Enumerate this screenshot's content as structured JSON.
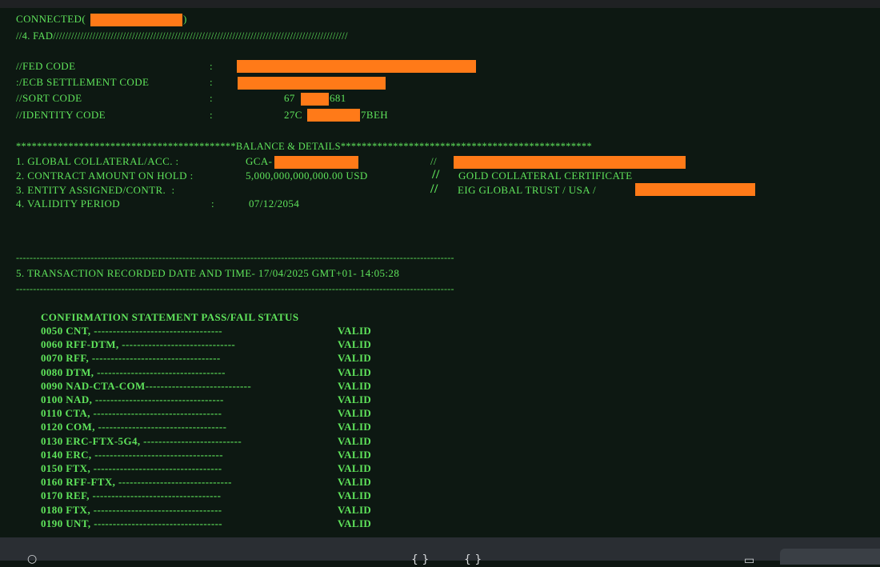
{
  "connection": {
    "prefix": "CONNECTED(",
    "suffix": ")"
  },
  "header": {
    "line": "//4. FAD/////////////////////////////////////////////////////////////////////////////////////////////////"
  },
  "codes": [
    {
      "label": "//FED CODE",
      "colon": ":",
      "value_pre": "",
      "value_post": ""
    },
    {
      "label": ":/ECB SETTLEMENT CODE",
      "colon": ":",
      "value_pre": "",
      "value_post": ""
    },
    {
      "label": "//SORT CODE",
      "colon": ":",
      "value_pre": "67",
      "value_post": "681"
    },
    {
      "label": "//IDENTITY CODE",
      "colon": ":",
      "value_pre": "27C",
      "value_post": "7BEH"
    }
  ],
  "balance": {
    "banner": "******************************************BALANCE & DETAILS************************************************",
    "rows": [
      {
        "label": "1. GLOBAL COLLATERAL/ACC. :",
        "value": "GCA-",
        "sep": "//",
        "extra": ""
      },
      {
        "label": "2. CONTRACT AMOUNT ON HOLD :",
        "value": "5,000,000,000,000.00 USD",
        "sep": "//",
        "extra": "GOLD COLLATERAL CERTIFICATE"
      },
      {
        "label": "3. ENTITY ASSIGNED/CONTR.  :",
        "value": "",
        "sep": "//",
        "extra": "EIG GLOBAL TRUST / USA /"
      },
      {
        "label": "4. VALIDITY PERIOD",
        "colon": ":",
        "value": "07/12/2054"
      }
    ]
  },
  "dash_line": "---------------------------------------------------------------------------------------------------------------------------------",
  "transaction": "5. TRANSACTION RECORDED DATE AND TIME- 17/04/2025 GMT+01- 14:05:28",
  "confirmation": {
    "title": "CONFIRMATION STATEMENT PASS/FAIL STATUS",
    "items": [
      {
        "line": "0050 CNT, ----------------------------------",
        "status": "VALID"
      },
      {
        "line": "0060 RFF-DTM, ------------------------------",
        "status": "VALID"
      },
      {
        "line": "0070 RFF, ----------------------------------",
        "status": "VALID"
      },
      {
        "line": "0080 DTM, ----------------------------------",
        "status": "VALID"
      },
      {
        "line": "0090 NAD-CTA-COM----------------------------",
        "status": "VALID"
      },
      {
        "line": "0100 NAD, ----------------------------------",
        "status": "VALID"
      },
      {
        "line": "0110 CTA, ----------------------------------",
        "status": "VALID"
      },
      {
        "line": "0120 COM, ----------------------------------",
        "status": "VALID"
      },
      {
        "line": "0130 ERC-FTX-5G4, --------------------------",
        "status": "VALID"
      },
      {
        "line": "0140 ERC, ----------------------------------",
        "status": "VALID"
      },
      {
        "line": "0150 FTX, ----------------------------------",
        "status": "VALID"
      },
      {
        "line": "0160 RFF-FTX, ------------------------------",
        "status": "VALID"
      },
      {
        "line": "0170 REF, ----------------------------------",
        "status": "VALID"
      },
      {
        "line": "0180 FTX, ----------------------------------",
        "status": "VALID"
      },
      {
        "line": "0190 UNT, ----------------------------------",
        "status": "VALID"
      }
    ]
  },
  "colors": {
    "text": "#5fe35b",
    "background": "#0d1812",
    "redaction": "#ff7a18"
  },
  "taskbar": {
    "icons": [
      "search-icon",
      "brace-icon",
      "brace-icon",
      "window-icon"
    ]
  }
}
